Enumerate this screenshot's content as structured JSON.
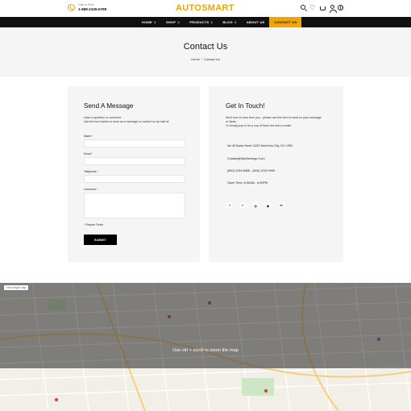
{
  "header": {
    "call_label": "Call us Free:",
    "call_number": "1-888-2345-6789",
    "logo_part1": "AUTO",
    "logo_part2": "SMART",
    "icons": [
      "search-icon",
      "heart-icon",
      "cart-icon",
      "user-icon",
      "globe-icon"
    ]
  },
  "nav": {
    "items": [
      {
        "label": "HOME",
        "caret": "∨"
      },
      {
        "label": "SHOP",
        "caret": "∨"
      },
      {
        "label": "PRODUCTS",
        "caret": "∨"
      },
      {
        "label": "BLOG",
        "caret": "∨"
      },
      {
        "label": "ABOUT US",
        "caret": ""
      },
      {
        "label": "CONTACT US",
        "caret": ""
      }
    ],
    "active": "CONTACT US"
  },
  "hero": {
    "title": "Contact Us",
    "breadcrumb": [
      "Home",
      "Contact Us"
    ],
    "separator": "/"
  },
  "form": {
    "title": "Send A Message",
    "intro_1": "Have a question or comment",
    "intro_2": "Use the form below to send us a message or contact us by mail at:",
    "name_label": "Name",
    "email_label": "Email",
    "telephone_label": "Telephone",
    "comment_label": "Comment",
    "required_mark": "*",
    "required_note": "* Require Fields",
    "submit_label": "SUBMIT"
  },
  "touch": {
    "title": "Get In Touch!",
    "intro_1": "We'd love to hear from you - please use the form to send us your message",
    "intro_2": "or ideas.",
    "intro_3": "Or simply pop in for a cup of fresh tea and a cookie:",
    "address": "No 40 Baria Sreet 133/2 NewYork City, NY, USD.",
    "email": "Contact@Wpthemego.Com",
    "phone": "(800) 1234 8888 - (800) 1234 9999",
    "hours": "Open Time: 8:00AM - 6:00PM",
    "socials": [
      "f",
      "t",
      "◎",
      "▶",
      "in"
    ]
  },
  "map": {
    "view_label": "View larger map",
    "hint": "Use ctrl + scroll to zoom the map"
  },
  "colors": {
    "accent": "#f0a500",
    "nav_bg": "#111111",
    "panel_bg": "#f5f5f5"
  }
}
